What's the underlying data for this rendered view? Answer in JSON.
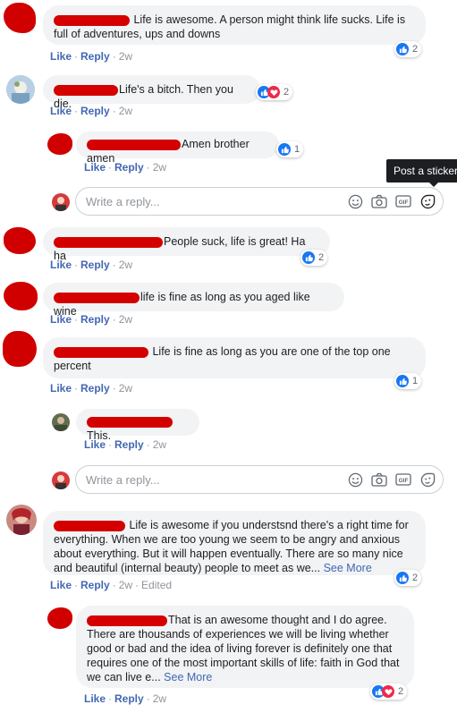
{
  "actions": {
    "like": "Like",
    "reply": "Reply",
    "edited": "Edited",
    "dot": "·"
  },
  "reply_box": {
    "placeholder": "Write a reply..."
  },
  "tooltip": {
    "text": "Post a sticker"
  },
  "comments": [
    {
      "text": " Life is awesome. A person might think life sucks. Life is full of adventures, ups and downs",
      "time": "2w",
      "reactions": {
        "types": [
          "like"
        ],
        "count": "2"
      }
    },
    {
      "text": "Life's a bitch. Then you die.",
      "time": "2w",
      "reactions": {
        "types": [
          "like",
          "love"
        ],
        "count": "2"
      }
    },
    {
      "text": "Amen brother amen",
      "time": "2w",
      "reactions": {
        "types": [
          "like"
        ],
        "count": "1"
      }
    },
    {
      "text": "People suck, life is great! Ha ha",
      "time": "2w",
      "reactions": {
        "types": [
          "like"
        ],
        "count": "2"
      }
    },
    {
      "text": "life is fine as long as you aged like wine",
      "time": "2w"
    },
    {
      "text": " Life is fine as long as you are one of the top one percent",
      "time": "2w",
      "reactions": {
        "types": [
          "like"
        ],
        "count": "1"
      }
    },
    {
      "text": " This.",
      "time": "2w"
    },
    {
      "text": " Life is awesome if you understsnd there's a right time for everything. When we are too young we seem to be angry and anxious about everything. But it will happen eventually. There are so many nice and beautiful (internal beauty) people to meet as we...",
      "see_more": "See More",
      "time": "2w",
      "reactions": {
        "types": [
          "like"
        ],
        "count": "2"
      }
    },
    {
      "text": "That is an awesome thought and I do agree. There are thousands of experiences we will be living whether good or bad and the idea of living forever is definitely one that requires one of the most important skills of life: faith in God that we can live e...",
      "see_more": "See More",
      "time": "2w",
      "reactions": {
        "types": [
          "like",
          "love"
        ],
        "count": "2"
      }
    }
  ],
  "icons": [
    "like-reaction-icon",
    "love-reaction-icon",
    "emoji-icon",
    "camera-icon",
    "gif-icon",
    "sticker-icon"
  ],
  "colors": {
    "link": "#4267b2",
    "like": "#1877f2",
    "love": "#f0284a",
    "redaction": "#d10000",
    "bubble": "#f2f3f5"
  }
}
